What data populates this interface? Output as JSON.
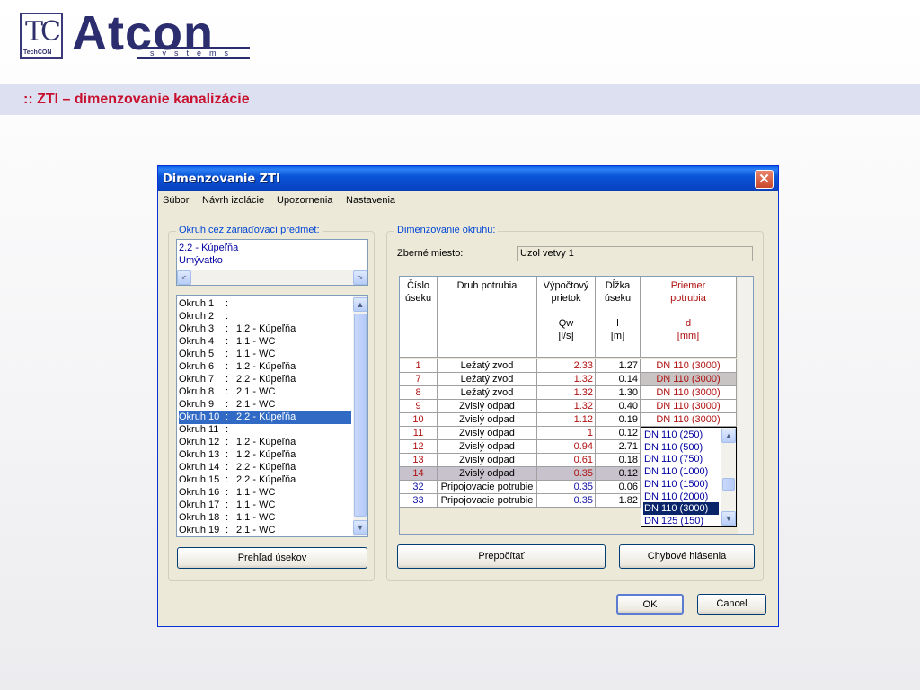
{
  "slide": {
    "logo_letters": "TC",
    "logo_sub": "TechCON",
    "brand": "Atcon",
    "brand_sub": "systems",
    "title": ":: ZTI – dimenzovanie kanalizácie",
    "colors": {
      "title_red": "#c8102e",
      "band": "#dde0f0",
      "brand_navy": "#2b2d6e"
    }
  },
  "window": {
    "title": "Dimenzovanie ZTI",
    "close_icon": "close-icon",
    "menu": [
      "Súbor",
      "Návrh izolácie",
      "Upozornenia",
      "Nastavenia"
    ],
    "left_group": {
      "label": "Okruh cez zariaďovací predmet:",
      "selected_items": [
        "2.2 - Kúpeľňa",
        "Umývatko"
      ],
      "okruhy": [
        {
          "name": "Okruh 1",
          "sep": ":",
          "value": ""
        },
        {
          "name": "Okruh 2",
          "sep": ":",
          "value": ""
        },
        {
          "name": "Okruh 3",
          "sep": ":",
          "value": "1.2 - Kúpeľňa"
        },
        {
          "name": "Okruh 4",
          "sep": ":",
          "value": "1.1 - WC"
        },
        {
          "name": "Okruh 5",
          "sep": ":",
          "value": "1.1 - WC"
        },
        {
          "name": "Okruh 6",
          "sep": ":",
          "value": "1.2 - Kúpeľňa"
        },
        {
          "name": "Okruh 7",
          "sep": ":",
          "value": "2.2 - Kúpeľňa"
        },
        {
          "name": "Okruh 8",
          "sep": ":",
          "value": "2.1 - WC"
        },
        {
          "name": "Okruh 9",
          "sep": ":",
          "value": "2.1 - WC"
        },
        {
          "name": "Okruh 10",
          "sep": ":",
          "value": "2.2 - Kúpeľňa"
        },
        {
          "name": "Okruh 11",
          "sep": ":",
          "value": ""
        },
        {
          "name": "Okruh 12",
          "sep": ":",
          "value": "1.2 - Kúpeľňa"
        },
        {
          "name": "Okruh 13",
          "sep": ":",
          "value": "1.2 - Kúpeľňa"
        },
        {
          "name": "Okruh 14",
          "sep": ":",
          "value": "2.2 - Kúpeľňa"
        },
        {
          "name": "Okruh 15",
          "sep": ":",
          "value": "2.2 - Kúpeľňa"
        },
        {
          "name": "Okruh 16",
          "sep": ":",
          "value": "1.1 - WC"
        },
        {
          "name": "Okruh 17",
          "sep": ":",
          "value": "1.1 - WC"
        },
        {
          "name": "Okruh 18",
          "sep": ":",
          "value": "1.1 - WC"
        },
        {
          "name": "Okruh 19",
          "sep": ":",
          "value": "2.1 - WC"
        }
      ],
      "selected_okruh": "Okruh 10",
      "prehlad_button": "Prehľad úsekov"
    },
    "right_group": {
      "label": "Dimenzovanie okruhu:",
      "zberne_label": "Zberné miesto:",
      "zberne_value": "Uzol vetvy 1",
      "columns": [
        {
          "l1": "Číslo",
          "l2": "úseku",
          "l3": "",
          "l4": ""
        },
        {
          "l1": "Druh potrubia",
          "l2": "",
          "l3": "",
          "l4": ""
        },
        {
          "l1": "Výpočtový",
          "l2": "prietok",
          "l3": "Qw",
          "l4": "[l/s]"
        },
        {
          "l1": "Dĺžka",
          "l2": "úseku",
          "l3": "l",
          "l4": "[m]"
        },
        {
          "l1": "Priemer",
          "l2": "potrubia",
          "l3": "d",
          "l4": "[mm]"
        }
      ],
      "rows": [
        {
          "cislo": "1",
          "druh": "Ležatý zvod",
          "qw": "2.33",
          "l": "1.27",
          "d": "DN 110 (3000)"
        },
        {
          "cislo": "7",
          "druh": "Ležatý zvod",
          "qw": "1.32",
          "l": "0.14",
          "d": "DN 110 (3000)"
        },
        {
          "cislo": "8",
          "druh": "Ležatý zvod",
          "qw": "1.32",
          "l": "1.30",
          "d": "DN 110 (3000)"
        },
        {
          "cislo": "9",
          "druh": "Zvislý odpad",
          "qw": "1.32",
          "l": "0.40",
          "d": "DN 110 (3000)"
        },
        {
          "cislo": "10",
          "druh": "Zvislý odpad",
          "qw": "1.12",
          "l": "0.19",
          "d": "DN 110 (3000)"
        },
        {
          "cislo": "11",
          "druh": "Zvislý odpad",
          "qw": "1",
          "l": "0.12",
          "d": ""
        },
        {
          "cislo": "12",
          "druh": "Zvislý odpad",
          "qw": "0.94",
          "l": "2.71",
          "d": ""
        },
        {
          "cislo": "13",
          "druh": "Zvislý odpad",
          "qw": "0.61",
          "l": "0.18",
          "d": ""
        },
        {
          "cislo": "14",
          "druh": "Zvislý odpad",
          "qw": "0.35",
          "l": "0.12",
          "d": ""
        },
        {
          "cislo": "32",
          "druh": "Pripojovacie potrubie",
          "qw": "0.35",
          "l": "0.06",
          "d": ""
        },
        {
          "cislo": "33",
          "druh": "Pripojovacie potrubie",
          "qw": "0.35",
          "l": "1.82",
          "d": ""
        }
      ],
      "dropdown_options": [
        "DN 110 (250)",
        "DN 110 (500)",
        "DN 110 (750)",
        "DN 110 (1000)",
        "DN 110 (1500)",
        "DN 110 (2000)",
        "DN 110 (3000)",
        "DN 125 (150)"
      ],
      "dropdown_selected": "DN 110 (3000)",
      "prepocitat_button": "Prepočítať",
      "chybove_button": "Chybové hlásenia"
    },
    "ok_button": "OK",
    "cancel_button": "Cancel"
  }
}
